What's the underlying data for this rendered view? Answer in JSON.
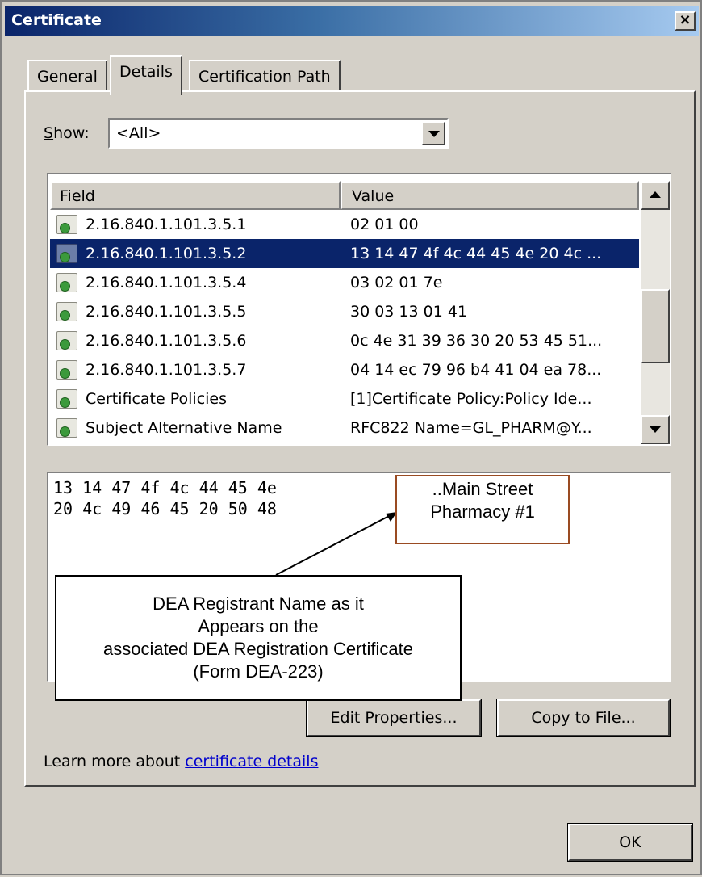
{
  "window": {
    "title": "Certificate",
    "close_label": "×"
  },
  "tabs": [
    {
      "label": "General"
    },
    {
      "label": "Details"
    },
    {
      "label": "Certification Path"
    }
  ],
  "show": {
    "label": "Show:",
    "accel": "S",
    "rest": "how:",
    "value": "<All>"
  },
  "list": {
    "header_field": "Field",
    "header_value": "Value",
    "rows": [
      {
        "field": "2.16.840.1.101.3.5.1",
        "value": "02 01 00"
      },
      {
        "field": "2.16.840.1.101.3.5.2",
        "value": "13 14 47 4f 4c 44 45 4e 20 4c ..."
      },
      {
        "field": "2.16.840.1.101.3.5.4",
        "value": "03 02 01 7e"
      },
      {
        "field": "2.16.840.1.101.3.5.5",
        "value": "30 03 13 01 41"
      },
      {
        "field": "2.16.840.1.101.3.5.6",
        "value": "0c 4e 31 39 36 30 20 53 45 51..."
      },
      {
        "field": "2.16.840.1.101.3.5.7",
        "value": "04 14 ec 79 96 b4 41 04 ea 78..."
      },
      {
        "field": "Certificate Policies",
        "value": "[1]Certificate Policy:Policy Ide..."
      },
      {
        "field": "Subject Alternative Name",
        "value": "RFC822 Name=GL_PHARM@Y..."
      }
    ]
  },
  "detail": {
    "line1": "13 14 47 4f 4c 44 45 4e",
    "line2": "20 4c 49 46 45 20 50 48"
  },
  "callouts": {
    "small_line1": "..Main Street",
    "small_line2": "Pharmacy #1",
    "big_line1": "DEA Registrant Name as it",
    "big_line2": "Appears on the",
    "big_line3": "associated DEA Registration Certificate",
    "big_line4": "(Form DEA-223)"
  },
  "buttons": {
    "edit_accel": "E",
    "edit_rest": "dit Properties...",
    "copy_accel": "C",
    "copy_rest": "opy to File...",
    "ok": "OK"
  },
  "learn": {
    "prefix": "Learn more about ",
    "link": "certificate details"
  }
}
